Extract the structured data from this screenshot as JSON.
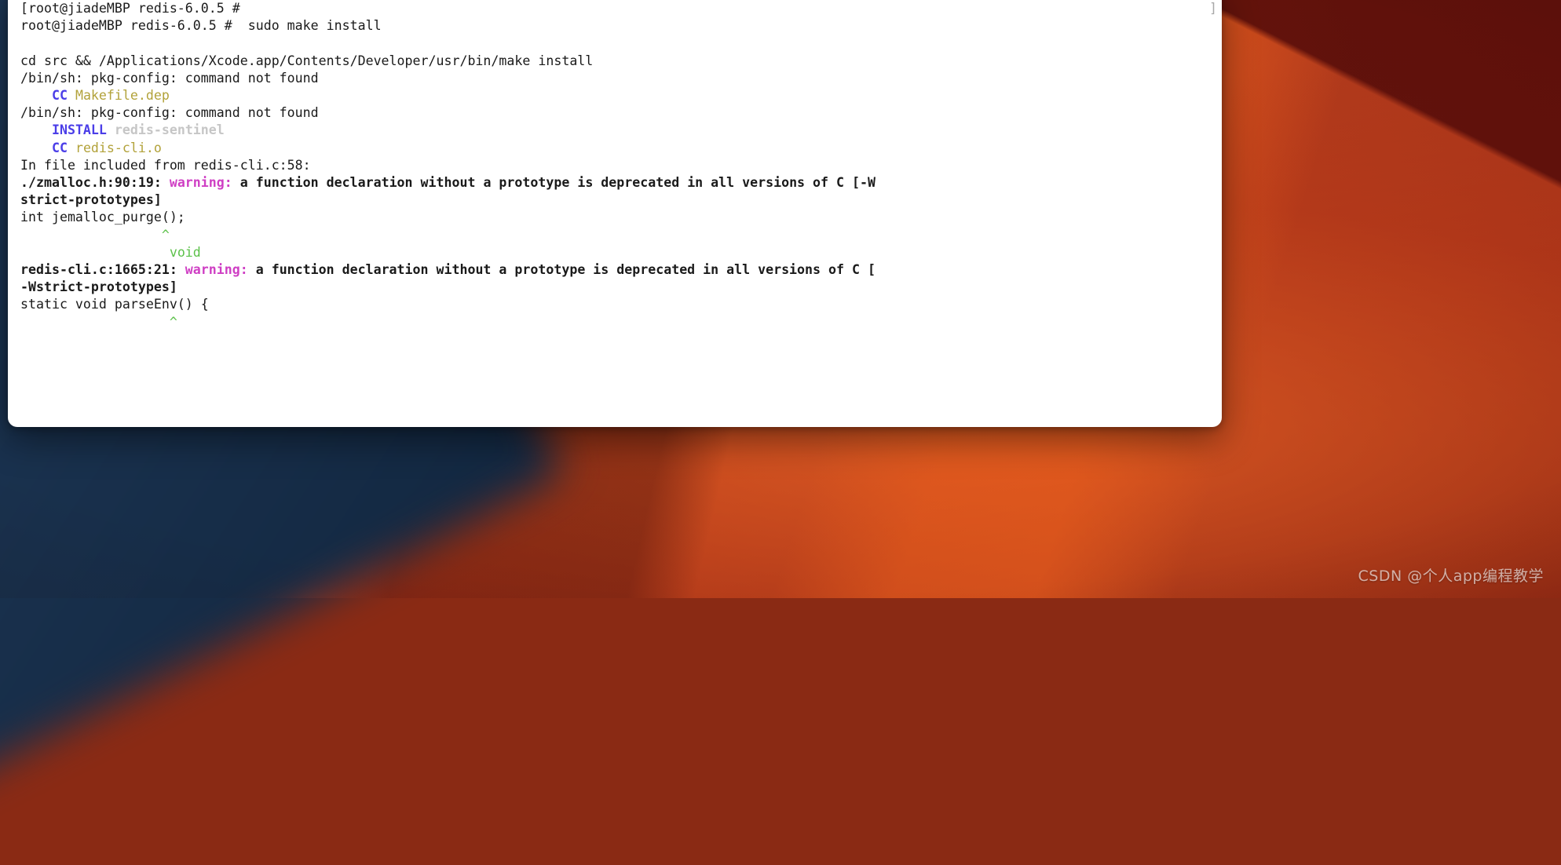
{
  "window": {
    "app": "Terminal",
    "scrollbar_glyph": "]"
  },
  "terminal": {
    "prompt": "root@jiadeMBP redis-6.0.5 #",
    "command": "sudo make install",
    "lines": [
      {
        "id": "l1",
        "segments": [
          {
            "text": "[root@jiadeMBP redis-6.0.5 #",
            "style": "plain"
          }
        ]
      },
      {
        "id": "l2",
        "segments": [
          {
            "text": "root@jiadeMBP redis-6.0.5 #  sudo make install",
            "style": "plain"
          }
        ]
      },
      {
        "id": "l3",
        "segments": [
          {
            "text": "",
            "style": "plain"
          }
        ]
      },
      {
        "id": "l4",
        "segments": [
          {
            "text": "cd src && /Applications/Xcode.app/Contents/Developer/usr/bin/make install",
            "style": "plain"
          }
        ]
      },
      {
        "id": "l5",
        "segments": [
          {
            "text": "/bin/sh: pkg-config: command not found",
            "style": "plain"
          }
        ]
      },
      {
        "id": "l6",
        "segments": [
          {
            "text": "    ",
            "style": "plain"
          },
          {
            "text": "CC",
            "style": "blue"
          },
          {
            "text": " ",
            "style": "plain"
          },
          {
            "text": "Makefile.dep",
            "style": "olive"
          }
        ]
      },
      {
        "id": "l7",
        "segments": [
          {
            "text": "/bin/sh: pkg-config: command not found",
            "style": "plain"
          }
        ]
      },
      {
        "id": "l8",
        "segments": [
          {
            "text": "    ",
            "style": "plain"
          },
          {
            "text": "INSTALL",
            "style": "blue"
          },
          {
            "text": " ",
            "style": "plain"
          },
          {
            "text": "redis-sentinel",
            "style": "gray"
          }
        ]
      },
      {
        "id": "l9",
        "segments": [
          {
            "text": "    ",
            "style": "plain"
          },
          {
            "text": "CC",
            "style": "blue"
          },
          {
            "text": " ",
            "style": "plain"
          },
          {
            "text": "redis-cli.o",
            "style": "olive"
          }
        ]
      },
      {
        "id": "l10",
        "segments": [
          {
            "text": "In file included from redis-cli.c:58:",
            "style": "plain"
          }
        ]
      },
      {
        "id": "l11",
        "segments": [
          {
            "text": "./zmalloc.h:90:19: ",
            "style": "bold"
          },
          {
            "text": "warning: ",
            "style": "magenta"
          },
          {
            "text": "a function declaration without a prototype is deprecated in all versions of C [-W",
            "style": "bold"
          }
        ]
      },
      {
        "id": "l12",
        "segments": [
          {
            "text": "strict-prototypes]",
            "style": "bold"
          }
        ]
      },
      {
        "id": "l13",
        "segments": [
          {
            "text": "int jemalloc_purge();",
            "style": "plain"
          }
        ]
      },
      {
        "id": "l14",
        "segments": [
          {
            "text": "                  ",
            "style": "plain"
          },
          {
            "text": "^",
            "style": "green"
          }
        ]
      },
      {
        "id": "l15",
        "segments": [
          {
            "text": "                   ",
            "style": "plain"
          },
          {
            "text": "void",
            "style": "green"
          }
        ]
      },
      {
        "id": "l16",
        "segments": [
          {
            "text": "redis-cli.c:1665:21: ",
            "style": "bold"
          },
          {
            "text": "warning: ",
            "style": "magenta"
          },
          {
            "text": "a function declaration without a prototype is deprecated in all versions of C [",
            "style": "bold"
          }
        ]
      },
      {
        "id": "l17",
        "segments": [
          {
            "text": "-Wstrict-prototypes]",
            "style": "bold"
          }
        ]
      },
      {
        "id": "l18",
        "segments": [
          {
            "text": "static void parseEnv() {",
            "style": "plain"
          }
        ]
      },
      {
        "id": "l19",
        "segments": [
          {
            "text": "                   ",
            "style": "plain"
          },
          {
            "text": "^",
            "style": "green"
          }
        ]
      }
    ]
  },
  "colors": {
    "terminal_background": "#ffffff",
    "terminal_text": "#1a1a1a",
    "ansi_blue": "#4b3ee8",
    "ansi_olive": "#b2a23a",
    "ansi_gray": "#c6c6c6",
    "ansi_magenta": "#cf3fc4",
    "ansi_green": "#5cc14a",
    "wallpaper_red": "#a03018",
    "wallpaper_orange": "#e85c1c",
    "wallpaper_navy": "#1c3553"
  },
  "watermark": {
    "text": "CSDN @个人app编程教学"
  }
}
